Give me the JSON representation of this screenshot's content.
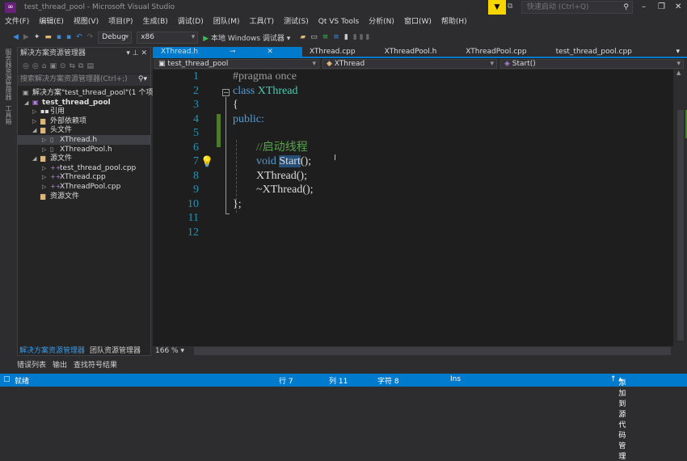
{
  "window": {
    "title": "test_thread_pool - Microsoft Visual Studio",
    "quick_launch_placeholder": "快速启动 (Ctrl+Q)"
  },
  "menu": [
    "文件(F)",
    "编辑(E)",
    "视图(V)",
    "项目(P)",
    "生成(B)",
    "调试(D)",
    "团队(M)",
    "工具(T)",
    "测试(S)",
    "Qt VS Tools",
    "分析(N)",
    "窗口(W)",
    "帮助(H)"
  ],
  "toolbar": {
    "config": "Debug",
    "platform": "x86",
    "run": "本地 Windows 调试器"
  },
  "side_strip": [
    "服务器资源管理器",
    "工具箱"
  ],
  "solution_explorer": {
    "title": "解决方案资源管理器",
    "search_placeholder": "搜索解决方案资源管理器(Ctrl+;)",
    "items": [
      {
        "label": "解决方案\"test_thread_pool\"(1 个项目)",
        "level": 0,
        "icon": "solution-icon"
      },
      {
        "label": "test_thread_pool",
        "level": 1,
        "icon": "project-icon",
        "bold": true
      },
      {
        "label": "引用",
        "level": 2,
        "icon": "references-icon"
      },
      {
        "label": "外部依赖项",
        "level": 2,
        "icon": "folder-icon"
      },
      {
        "label": "头文件",
        "level": 2,
        "icon": "folder-icon"
      },
      {
        "label": "XThread.h",
        "level": 3,
        "icon": "header-file-icon",
        "selected": true
      },
      {
        "label": "XThreadPool.h",
        "level": 3,
        "icon": "header-file-icon"
      },
      {
        "label": "源文件",
        "level": 2,
        "icon": "folder-icon"
      },
      {
        "label": "test_thread_pool.cpp",
        "level": 3,
        "icon": "cpp-file-icon"
      },
      {
        "label": "XThread.cpp",
        "level": 3,
        "icon": "cpp-file-icon"
      },
      {
        "label": "XThreadPool.cpp",
        "level": 3,
        "icon": "cpp-file-icon"
      },
      {
        "label": "资源文件",
        "level": 2,
        "icon": "folder-icon"
      }
    ],
    "bottom_tabs": [
      "解决方案资源管理器",
      "团队资源管理器"
    ]
  },
  "editor": {
    "tabs": [
      "XThread.h",
      "XThread.cpp",
      "XThreadPool.h",
      "XThreadPool.cpp",
      "test_thread_pool.cpp"
    ],
    "active_tab": "XThread.h",
    "nav": {
      "project": "test_thread_pool",
      "class": "XThread",
      "member": "Start()"
    },
    "zoom": "166 %",
    "line_numbers": [
      "1",
      "2",
      "3",
      "4",
      "5",
      "6",
      "7",
      "8",
      "9",
      "10",
      "11",
      "12"
    ],
    "code": {
      "l1": "#pragma once",
      "l2a": "class ",
      "l2b": "XThread",
      "l3": "{",
      "l4": "public:",
      "l6": "//启动线程",
      "l7a": "void ",
      "l7b": "Start",
      "l7c": "();",
      "l8": "XThread();",
      "l9": "~XThread();",
      "l10": "};"
    }
  },
  "output_tabs": [
    "错误列表",
    "输出",
    "查找符号结果"
  ],
  "status": {
    "ready": "就绪",
    "line": "行 7",
    "col": "列 11",
    "char": "字符 8",
    "mode": "Ins",
    "source_control": "添加到源代码管理"
  },
  "colors": {
    "accent": "#007acc",
    "keyword": "#569cd6",
    "type": "#4ec9b0",
    "comment": "#57a64a"
  }
}
